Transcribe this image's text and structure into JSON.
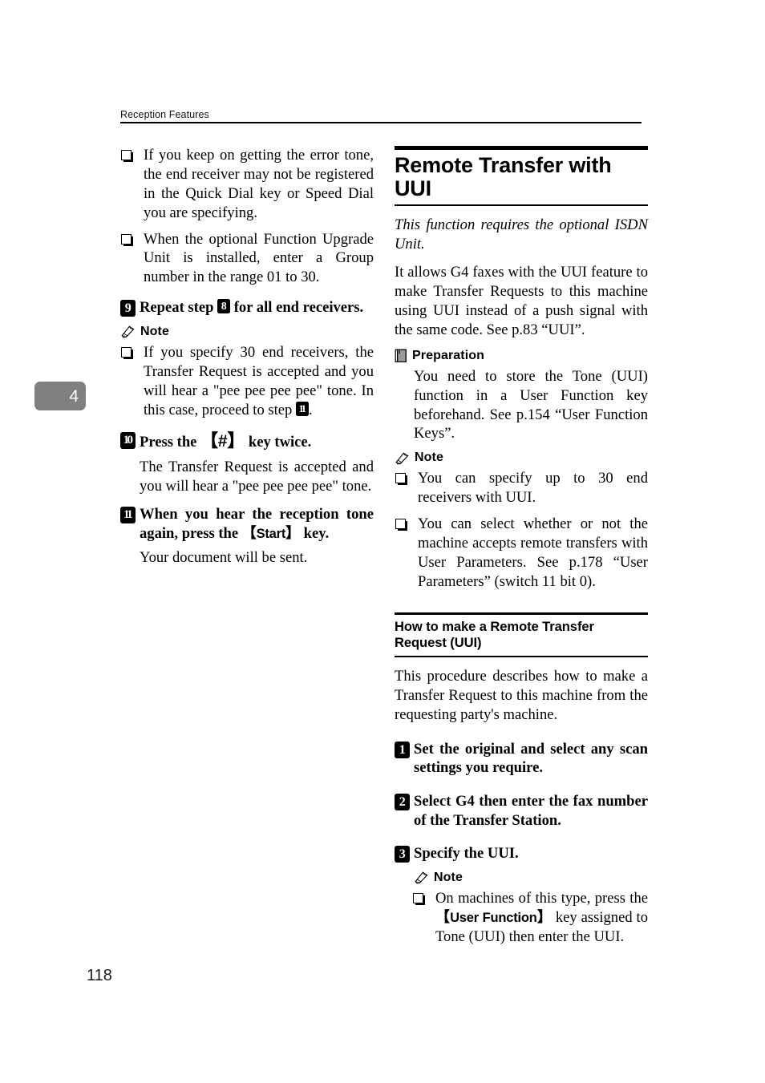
{
  "header": {
    "running_title": "Reception Features"
  },
  "chapter_tab": {
    "number": "4"
  },
  "folio": {
    "page_number": "118"
  },
  "left_column": {
    "top_notes": [
      "If you keep on getting the error tone, the end receiver may not be registered in the Quick Dial key or Speed Dial you are specifying.",
      "When the optional Function Upgrade Unit is installed, enter a Group number in the range 01 to 30."
    ],
    "step9": {
      "number": "9",
      "text_before": "Repeat step ",
      "inline_step": "8",
      "text_after": " for all end receivers."
    },
    "note1": {
      "icon": "pencil-icon",
      "label": "Note",
      "items_before": "If you specify 30 end receivers, the Transfer Request is accepted and you will hear a \"pee pee pee pee\" tone. In this case, proceed to step ",
      "items_inline_step": "11",
      "items_after": "."
    },
    "step10": {
      "number": "10",
      "text_before": "Press the ",
      "key": "#",
      "text_after": " key twice.",
      "body": "The Transfer Request is accepted and you will hear a \"pee pee pee pee\" tone."
    },
    "step11": {
      "number": "11",
      "text_before": "When you hear the reception tone again, press the ",
      "key": "Start",
      "text_after": " key.",
      "body": "Your document will be sent."
    }
  },
  "right_column": {
    "section": {
      "title": "Remote Transfer with UUI",
      "intro_italic": "This function requires the optional ISDN Unit.",
      "intro_body": "It allows G4 faxes with the UUI feature to make Transfer Requests to this machine using UUI instead of a push signal with the same code. See p.83 “UUI”."
    },
    "preparation": {
      "icon": "book-icon",
      "label": "Preparation",
      "body": "You need to store the Tone (UUI) function in a User Function key beforehand. See p.154 “User Function Keys”."
    },
    "note": {
      "icon": "pencil-icon",
      "label": "Note",
      "items": [
        "You can specify up to 30 end receivers with UUI.",
        "You can select whether or not the machine accepts remote transfers with User Parameters. See p.178 “User Parameters” (switch 11 bit 0)."
      ]
    },
    "subsection": {
      "title": "How to make a Remote Transfer Request (UUI)",
      "intro": "This procedure describes how to make a Transfer Request to this machine from the requesting party's machine."
    },
    "steps": [
      {
        "number": "1",
        "text": "Set the original and select any scan settings you require."
      },
      {
        "number": "2",
        "text": "Select G4 then enter the fax number of the Transfer Station."
      },
      {
        "number": "3",
        "text": "Specify the UUI."
      }
    ],
    "final_note": {
      "icon": "pencil-icon",
      "label": "Note",
      "item_before": "On machines of this type, press the ",
      "key": "User Function",
      "item_after": " key assigned to Tone (UUI) then enter the UUI."
    }
  },
  "colors": {
    "text": "#000000",
    "chapter_tab_bg": "#808080",
    "page_bg": "#ffffff"
  }
}
